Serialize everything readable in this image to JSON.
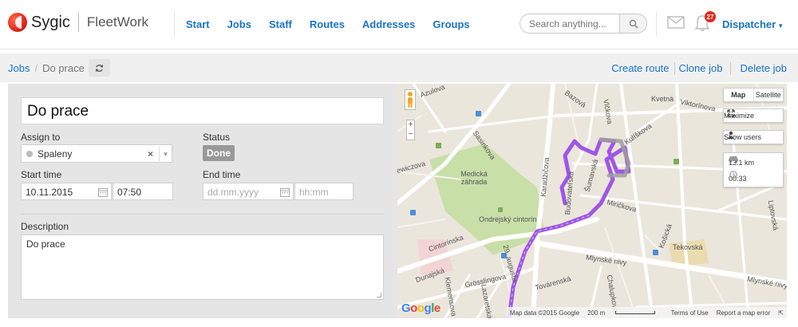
{
  "app": {
    "brand": "Sygic",
    "product": "FleetWork"
  },
  "nav": {
    "items": [
      "Start",
      "Jobs",
      "Staff",
      "Routes",
      "Addresses",
      "Groups"
    ]
  },
  "search": {
    "placeholder": "Search anything..."
  },
  "notifications": {
    "count": "27"
  },
  "user": {
    "role": "Dispatcher"
  },
  "breadcrumb": {
    "root": "Jobs",
    "current": "Do prace"
  },
  "actions": {
    "create_route": "Create route",
    "clone_job": "Clone job",
    "delete_job": "Delete job"
  },
  "job": {
    "title": "Do prace",
    "assign_label": "Assign to",
    "assignee": "Spaleny",
    "status_label": "Status",
    "status": "Done",
    "start_label": "Start time",
    "start_date": "10.11.2015",
    "start_time": "07:50",
    "end_label": "End time",
    "end_date_placeholder": "dd.mm.yyyy",
    "end_time_placeholder": "hh:mm",
    "description_label": "Description",
    "description": "Do prace"
  },
  "map": {
    "type_map": "Map",
    "type_satellite": "Satellite",
    "maximize": "Maximize",
    "show_users": "Show users",
    "distance": "13.1 km",
    "duration": "00:33",
    "labels": {
      "azulova": "Azulova",
      "bazova": "Bazová",
      "kvetna": "Kvetná",
      "viktorinova": "Viktorínova",
      "vlckova": "Vlčkova",
      "kuliskova": "Kulíškova",
      "sasinkova": "Sasinkova",
      "medicka": "Medická záhrada",
      "karadzicova": "Karadžičova",
      "budovatelska": "Budovateľská",
      "sumavska": "Šumavská",
      "ondrejsky": "Ondrejský cintorín",
      "cintorinska": "Cintorínska",
      "miricova": "Miričkova",
      "mlynske": "Mlynské nivy",
      "kosicka": "Košická",
      "tekovska": "Tekovská",
      "liptovska": "Liptovská",
      "augusta": "29. augusta",
      "dunajska": "Dunajská",
      "grosslingova": "Grösslingova",
      "tovarenska": "Továrenská",
      "lazaretska": "Lazaretská",
      "mlynske2": "Mlynské nivy",
      "chalupkova": "Chalupkova",
      "kleinova": "Klemensova",
      "jewiczova": "Jewiczova"
    },
    "attribution": "Map data ©2015 Google",
    "scale": "200 m",
    "terms": "Terms of Use",
    "report": "Report a map error",
    "google": "Google",
    "colors": {
      "route": "#9b4ee6",
      "route_gray": "#9e9e9e",
      "park": "#c8dfa8"
    }
  }
}
